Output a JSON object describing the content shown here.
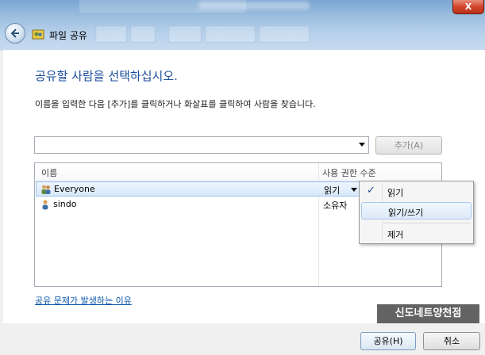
{
  "window": {
    "title": "파일 공유",
    "close_label": "X"
  },
  "main": {
    "heading": "공유할 사람을 선택하십시오.",
    "instruction": "이름을 입력한 다음 [추가]를 클릭하거나 화살표를 클릭하여 사람을 찾습니다.",
    "input_value": "",
    "add_button": "추가(A)"
  },
  "list": {
    "columns": [
      "이름",
      "사용 권한 수준"
    ],
    "rows": [
      {
        "name": "Everyone",
        "permission": "읽기",
        "icon": "group-icon",
        "selected": true
      },
      {
        "name": "sindo",
        "permission": "소유자",
        "icon": "user-icon",
        "selected": false
      }
    ]
  },
  "permission_menu": {
    "items": [
      {
        "label": "읽기",
        "checked": true
      },
      {
        "label": "읽기/쓰기",
        "highlighted": true
      },
      {
        "label": "제거"
      }
    ]
  },
  "help_link": "공유 문제가 발생하는 이유",
  "watermark": "신도네트양천점",
  "footer": {
    "share_button": "공유(H)",
    "cancel_button": "취소"
  },
  "colors": {
    "heading": "#1a4d9b",
    "link": "#0a56a8",
    "selection": "#d7e8fa"
  }
}
